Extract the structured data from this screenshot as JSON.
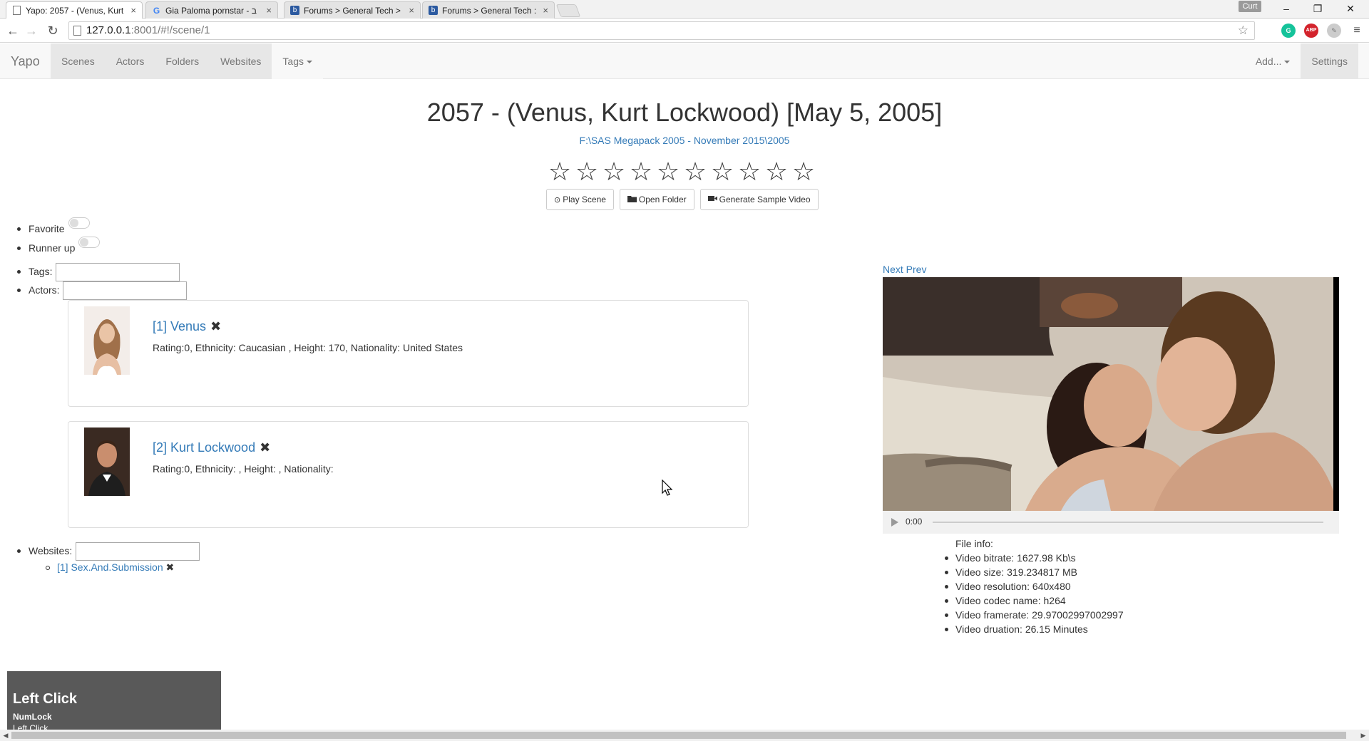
{
  "browser": {
    "tabs": [
      {
        "title": "Yapo: 2057 - (Venus, Kurt",
        "favicon": "page-icon",
        "active": true
      },
      {
        "title": "Gia Paloma pornstar - ב",
        "favicon": "google-icon",
        "active": false
      },
      {
        "title": "Forums > General Tech >",
        "favicon": "forum-icon",
        "active": false
      },
      {
        "title": "Forums > General Tech :",
        "favicon": "forum-icon",
        "active": false
      }
    ],
    "user_badge": "Curt",
    "window_controls": {
      "minimize": "–",
      "restore": "❐",
      "close": "✕"
    },
    "url_host": "127.0.0.1",
    "url_rest": ":8001/#!/scene/1",
    "ext_abp": "ABP"
  },
  "navbar": {
    "brand": "Yapo",
    "links": [
      "Scenes",
      "Actors",
      "Folders",
      "Websites"
    ],
    "tags_label": "Tags",
    "add_label": "Add...",
    "settings_label": "Settings"
  },
  "scene": {
    "title": "2057 - (Venus, Kurt Lockwood) [May 5, 2005]",
    "path": "F:\\SAS Megapack 2005 - November 2015\\2005",
    "rating": 0,
    "star_glyph": "☆",
    "buttons": {
      "play": "Play Scene",
      "open_folder": "Open Folder",
      "generate": "Generate Sample Video"
    }
  },
  "fields": {
    "favorite_label": "Favorite",
    "runner_up_label": "Runner up",
    "tags_label": "Tags:",
    "actors_label": "Actors:",
    "websites_label": "Websites:"
  },
  "actors": [
    {
      "name": "[1] Venus",
      "info": "Rating:0, Ethnicity: Caucasian , Height: 170, Nationality: United States"
    },
    {
      "name": "[2] Kurt Lockwood",
      "info": "Rating:0, Ethnicity: , Height: , Nationality:"
    }
  ],
  "websites": [
    {
      "name": "[1] Sex.And.Submission"
    }
  ],
  "remove_glyph": "✖",
  "video": {
    "nav_label": "Next Prev",
    "time": "0:00"
  },
  "file_info": {
    "title": "File info:",
    "items": [
      "Video bitrate: 1627.98 Kb\\s",
      "Video size: 319.234817 MB",
      "Video resolution: 640x480",
      "Video codec name: h264",
      "Video framerate: 29.97002997002997",
      "Video druation: 26.15 Minutes"
    ]
  },
  "overlay": {
    "main": "Left Click",
    "sub1": "NumLock",
    "sub2": "Left Click"
  }
}
